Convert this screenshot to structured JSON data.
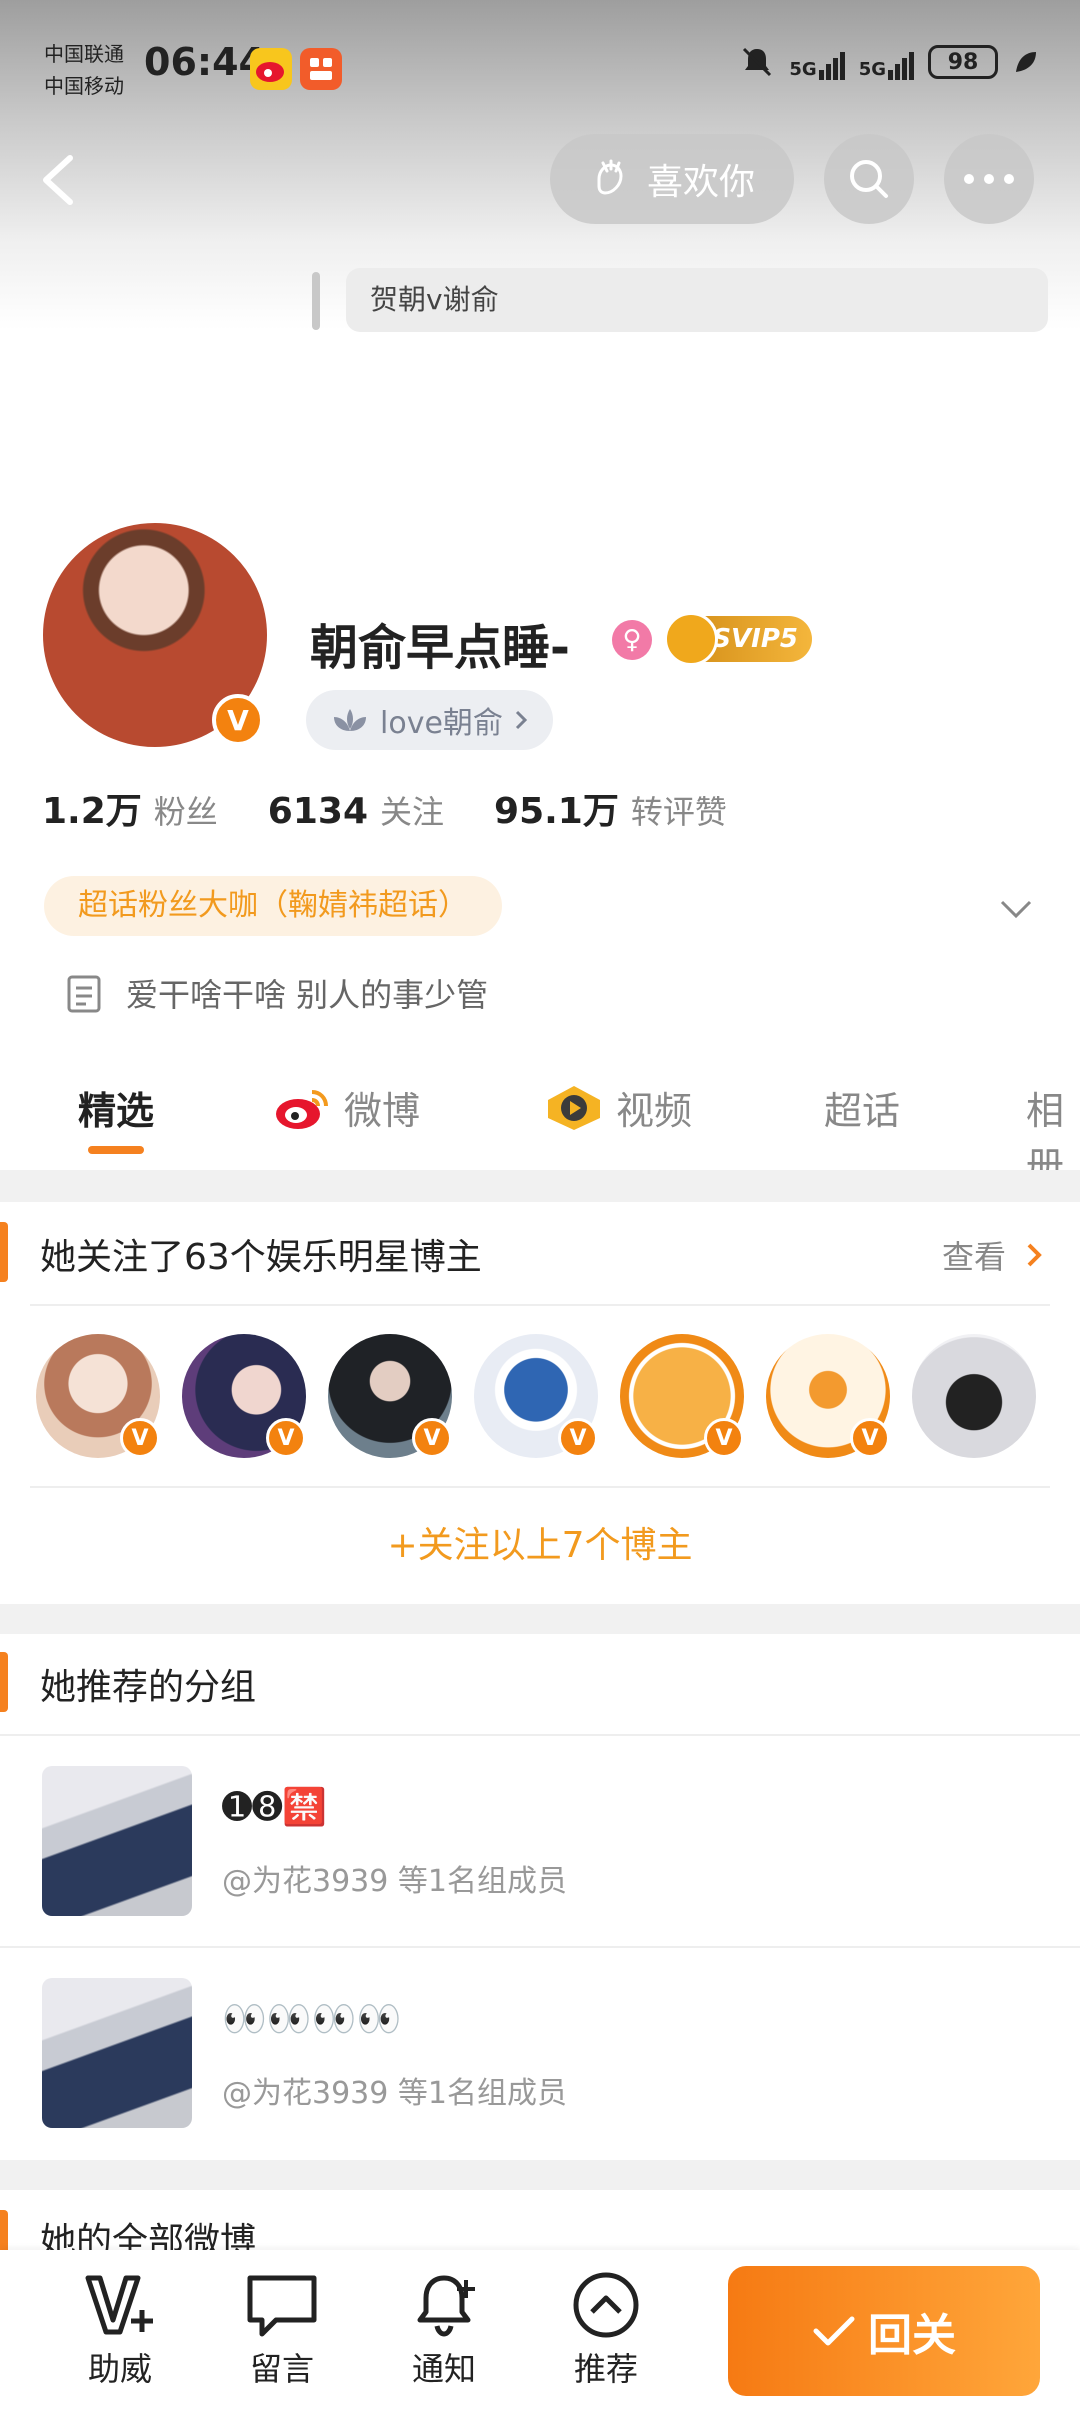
{
  "status_bar": {
    "carrier_1": "中国联通",
    "carrier_2": "中国移动",
    "time": "06:44",
    "net_1": "5G",
    "net_2": "5G",
    "battery": "98"
  },
  "nav": {
    "like_label": "喜欢你"
  },
  "profile": {
    "quote": "贺朝v谢俞",
    "name": "朝俞早点睡-",
    "vip_label": "SVIP5",
    "fan_tag": "love朝俞",
    "verified_mark": "V",
    "stats": [
      {
        "num": "1.2万",
        "label": "粉丝"
      },
      {
        "num": "6134",
        "label": "关注"
      },
      {
        "num": "95.1万",
        "label": "转评赞"
      }
    ],
    "chaohua_badge": "超话粉丝大咖（鞠婧祎超话）",
    "bio": "爱干啥干啥 别人的事少管"
  },
  "tabs": [
    {
      "label": "精选"
    },
    {
      "label": "微博"
    },
    {
      "label": "视频"
    },
    {
      "label": "超话"
    },
    {
      "label": "相册"
    }
  ],
  "following_section": {
    "title": "她关注了63个娱乐明星博主",
    "view_label": "查看",
    "follow_all": "+关注以上7个博主",
    "avatars": [
      {
        "color": "#e8c9b8",
        "name": "avatar-1"
      },
      {
        "color": "#3b3f6b",
        "name": "avatar-2"
      },
      {
        "color": "#4a5a66",
        "name": "avatar-3"
      },
      {
        "color": "#2f66b3",
        "name": "avatar-4"
      },
      {
        "color": "#f39a2f",
        "name": "avatar-5"
      },
      {
        "color": "#fbe3c4",
        "name": "avatar-6"
      },
      {
        "color": "#e7e7ea",
        "name": "avatar-7"
      }
    ]
  },
  "groups_section": {
    "title": "她推荐的分组",
    "items": [
      {
        "name": "➊➑🈲",
        "sub": "@为花3939 等1名组成员"
      },
      {
        "name": "👀👀👀👀",
        "sub": "@为花3939 等1名组成员"
      }
    ]
  },
  "all_posts_title": "她的全部微博",
  "bottom_bar": {
    "items": [
      {
        "label": "助威"
      },
      {
        "label": "留言"
      },
      {
        "label": "通知"
      },
      {
        "label": "推荐"
      }
    ],
    "followback_label": "回关"
  },
  "colors": {
    "accent": "#f5811f",
    "tag_text": "#f29a1e"
  }
}
